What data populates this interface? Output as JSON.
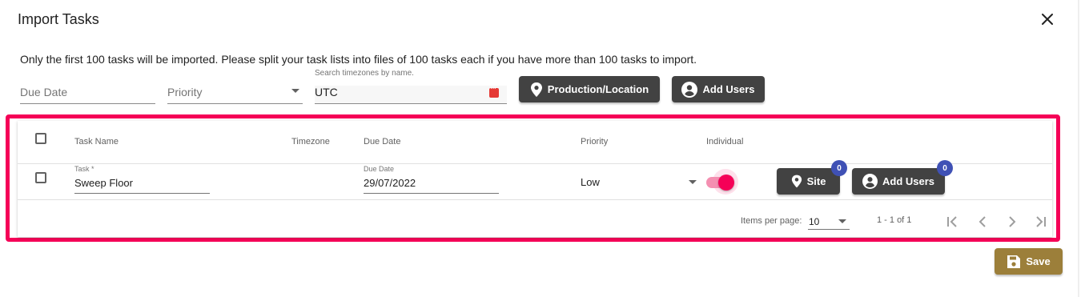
{
  "dialog": {
    "title": "Import Tasks",
    "notice": "Only the first 100 tasks will be imported. Please split your task lists into files of 100 tasks each if you have more than 100 tasks to import."
  },
  "filters": {
    "due_date_placeholder": "Due Date",
    "priority_placeholder": "Priority",
    "timezone_label": "Search timezones by name.",
    "timezone_value": "UTC",
    "production_location_label": "Production/Location",
    "add_users_label": "Add Users"
  },
  "table": {
    "columns": [
      "Task Name",
      "Timezone",
      "Due Date",
      "Priority",
      "Individual"
    ],
    "rows": [
      {
        "task_label": "Task *",
        "task_name": "Sweep Floor",
        "due_date_label": "Due Date",
        "due_date": "29/07/2022",
        "priority": "Low",
        "individual": true,
        "site_label": "Site",
        "site_count": "0",
        "add_users_label": "Add Users",
        "users_count": "0"
      }
    ],
    "paginator": {
      "items_per_page_label": "Items per page:",
      "items_per_page": "10",
      "range": "1 - 1 of 1"
    }
  },
  "actions": {
    "save_label": "Save"
  },
  "colors": {
    "accent": "#f50057",
    "badge": "#3f51b5",
    "dark_button": "#424242",
    "save_button": "#9c7f3a"
  },
  "icons": [
    "close-icon",
    "location-pin-icon",
    "account-circle-icon",
    "first-page-icon",
    "chevron-left-icon",
    "chevron-right-icon",
    "last-page-icon",
    "save-icon"
  ]
}
